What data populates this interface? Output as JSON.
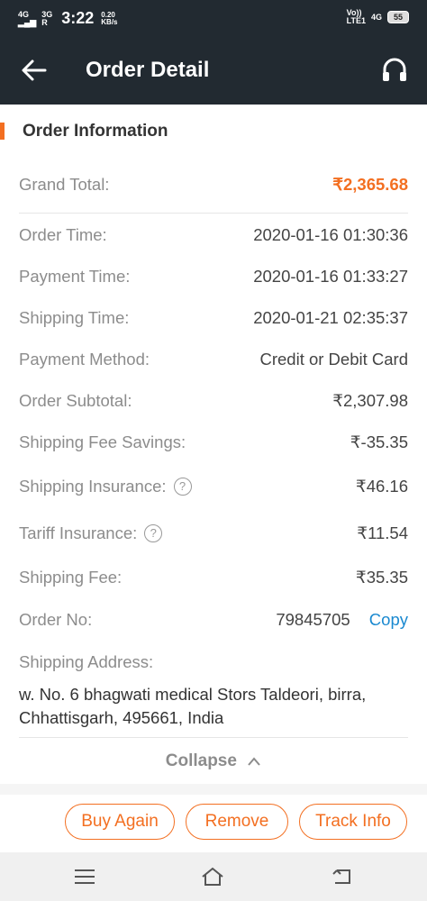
{
  "status_bar": {
    "signal1": "4G",
    "signal2_top": "3G",
    "signal2_bottom": "R",
    "time": "3:22",
    "speed_value": "0.20",
    "speed_unit": "KB/s",
    "volte_top": "Vo))",
    "volte_bottom": "LTE1",
    "network": "4G",
    "battery": "55"
  },
  "app_bar": {
    "title": "Order Detail"
  },
  "order_info": {
    "section_title": "Order Information",
    "grand_total_label": "Grand Total:",
    "grand_total_value": "₹2,365.68",
    "order_time_label": "Order Time:",
    "order_time_value": "2020-01-16 01:30:36",
    "payment_time_label": "Payment Time:",
    "payment_time_value": "2020-01-16 01:33:27",
    "shipping_time_label": "Shipping Time:",
    "shipping_time_value": "2020-01-21 02:35:37",
    "payment_method_label": "Payment Method:",
    "payment_method_value": "Credit or Debit Card",
    "order_subtotal_label": "Order Subtotal:",
    "order_subtotal_value": "₹2,307.98",
    "shipping_fee_savings_label": "Shipping Fee Savings:",
    "shipping_fee_savings_value": "₹-35.35",
    "shipping_insurance_label": "Shipping Insurance:",
    "shipping_insurance_value": "₹46.16",
    "tariff_insurance_label": "Tariff Insurance:",
    "tariff_insurance_value": "₹11.54",
    "shipping_fee_label": "Shipping Fee:",
    "shipping_fee_value": "₹35.35",
    "order_no_label": "Order No:",
    "order_no_value": "79845705",
    "copy_label": "Copy",
    "shipping_address_label": "Shipping Address:",
    "shipping_address_value": "w. No. 6 bhagwati medical Stors Taldeori, birra, Chhattisgarh, 495661, India",
    "collapse_label": "Collapse",
    "help_glyph": "?"
  },
  "actions": {
    "buy_again": "Buy Again",
    "remove": "Remove",
    "track_info": "Track Info"
  },
  "colors": {
    "accent": "#f36f21",
    "header_bg": "#222a31",
    "link": "#1a89d0"
  }
}
